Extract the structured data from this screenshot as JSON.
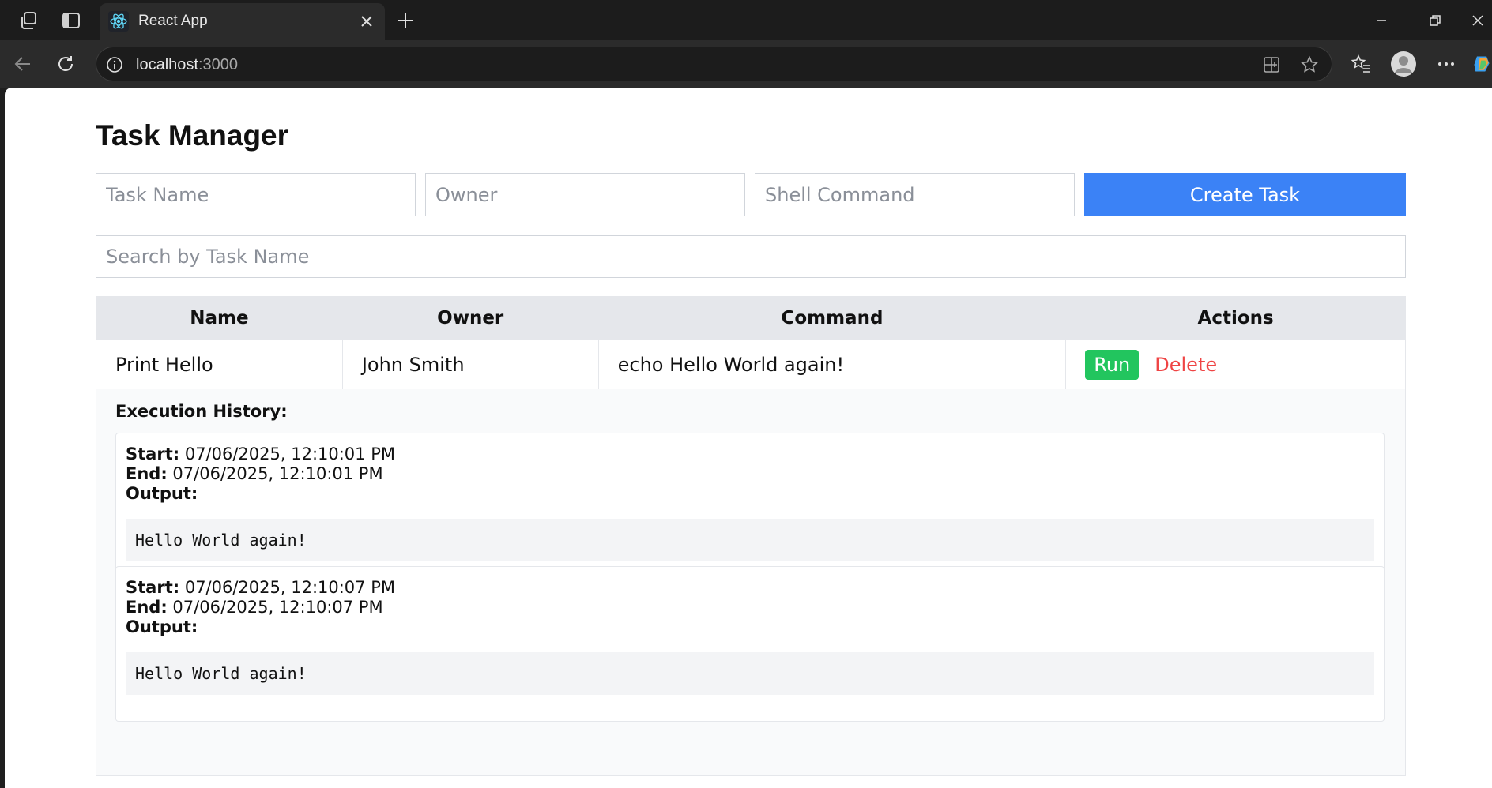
{
  "browser": {
    "tab_title": "React App",
    "url_host": "localhost",
    "url_port": ":3000"
  },
  "page": {
    "title": "Task Manager",
    "form": {
      "task_name_placeholder": "Task Name",
      "owner_placeholder": "Owner",
      "command_placeholder": "Shell Command",
      "create_label": "Create Task"
    },
    "search_placeholder": "Search by Task Name",
    "table": {
      "headers": [
        "Name",
        "Owner",
        "Command",
        "Actions"
      ],
      "rows": [
        {
          "name": "Print Hello",
          "owner": "John Smith",
          "command": "echo Hello World again!",
          "run_label": "Run",
          "delete_label": "Delete"
        }
      ]
    },
    "history": {
      "title": "Execution History:",
      "start_label": "Start:",
      "end_label": "End:",
      "output_label": "Output:",
      "runs": [
        {
          "start": "07/06/2025, 12:10:01 PM",
          "end": "07/06/2025, 12:10:01 PM",
          "output": "Hello World again!"
        },
        {
          "start": "07/06/2025, 12:10:07 PM",
          "end": "07/06/2025, 12:10:07 PM",
          "output": "Hello World again!"
        }
      ]
    }
  },
  "colors": {
    "primary": "#3b82f6",
    "success": "#22c55e",
    "danger": "#ef4444"
  },
  "icons": [
    "workspaces-icon",
    "tab-actions-icon",
    "react-favicon-icon",
    "close-tab-icon",
    "new-tab-icon",
    "minimize-icon",
    "restore-icon",
    "close-window-icon",
    "back-icon",
    "reload-icon",
    "site-info-icon",
    "split-screen-icon",
    "favorite-star-icon",
    "favorites-icon",
    "profile-icon",
    "more-icon",
    "copilot-icon"
  ]
}
